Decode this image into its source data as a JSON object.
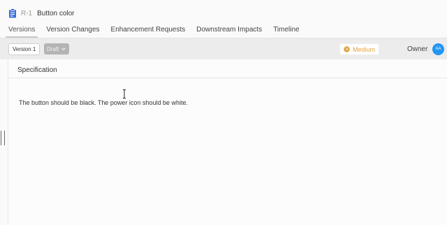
{
  "header": {
    "req_id": "R-1",
    "title": "Button color"
  },
  "tabs": [
    {
      "label": "Versions",
      "active": true
    },
    {
      "label": "Version Changes",
      "active": false
    },
    {
      "label": "Enhancement Requests",
      "active": false
    },
    {
      "label": "Downstream Impacts",
      "active": false
    },
    {
      "label": "Timeline",
      "active": false
    }
  ],
  "toolbar": {
    "version_label": "Version 1",
    "status_label": "Draft",
    "priority_label": "Medium",
    "owner_label": "Owner",
    "owner_initials": "AA"
  },
  "colors": {
    "accent": "#2196f3",
    "priority_medium": "#e0a53d",
    "status_draft": "#b4b4b4"
  },
  "spec": {
    "title": "Specification",
    "body": "The button should be black. The power icon should be white."
  }
}
